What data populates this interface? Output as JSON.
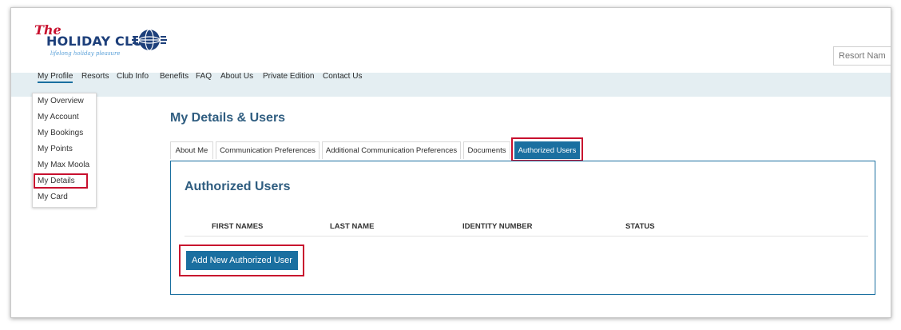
{
  "logo": {
    "the": "The",
    "main": "HOLIDAY CLUB",
    "tagline": "lifelong holiday pleasure"
  },
  "search": {
    "placeholder": "Resort Nam"
  },
  "nav": {
    "items": [
      {
        "label": "My Profile"
      },
      {
        "label": "Resorts"
      },
      {
        "label": "Club Info"
      },
      {
        "label": "Benefits"
      },
      {
        "label": "FAQ"
      },
      {
        "label": "About Us"
      },
      {
        "label": "Private Edition"
      },
      {
        "label": "Contact Us"
      }
    ]
  },
  "dropdown": {
    "items": [
      {
        "label": "My Overview"
      },
      {
        "label": "My Account"
      },
      {
        "label": "My Bookings"
      },
      {
        "label": "My Points"
      },
      {
        "label": "My Max Moola"
      },
      {
        "label": "My Details"
      },
      {
        "label": "My Card"
      }
    ]
  },
  "page": {
    "title": "My Details & Users"
  },
  "tabs": [
    {
      "label": "About Me"
    },
    {
      "label": "Communication Preferences"
    },
    {
      "label": "Additional Communication Preferences"
    },
    {
      "label": "Documents"
    },
    {
      "label": "Authorized Users"
    }
  ],
  "panel": {
    "title": "Authorized Users",
    "columns": [
      "FIRST NAMES",
      "LAST NAME",
      "IDENTITY NUMBER",
      "STATUS"
    ],
    "add_button": "Add New Authorized User"
  },
  "colors": {
    "accent": "#1a6fa0",
    "highlight": "#c8102e",
    "navbar": "#e4eef2",
    "title": "#2f5d80"
  }
}
